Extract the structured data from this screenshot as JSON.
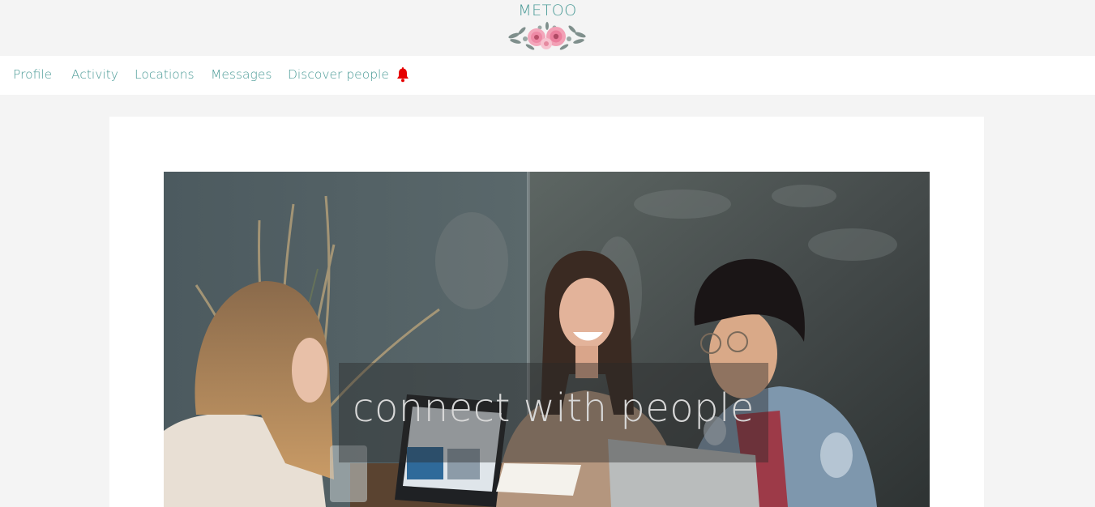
{
  "brand": {
    "title": "METOO"
  },
  "nav": {
    "items": [
      {
        "label": "Profile"
      },
      {
        "label": "Activity"
      },
      {
        "label": "Locations"
      },
      {
        "label": "Messages"
      },
      {
        "label": "Discover people"
      }
    ],
    "bell_icon": "bell-icon",
    "bell_color": "#e60000"
  },
  "hero": {
    "tagline": "connect with people"
  },
  "colors": {
    "accent": "#4b9b97",
    "page_background": "#f4f4f4",
    "card_background": "#ffffff"
  }
}
